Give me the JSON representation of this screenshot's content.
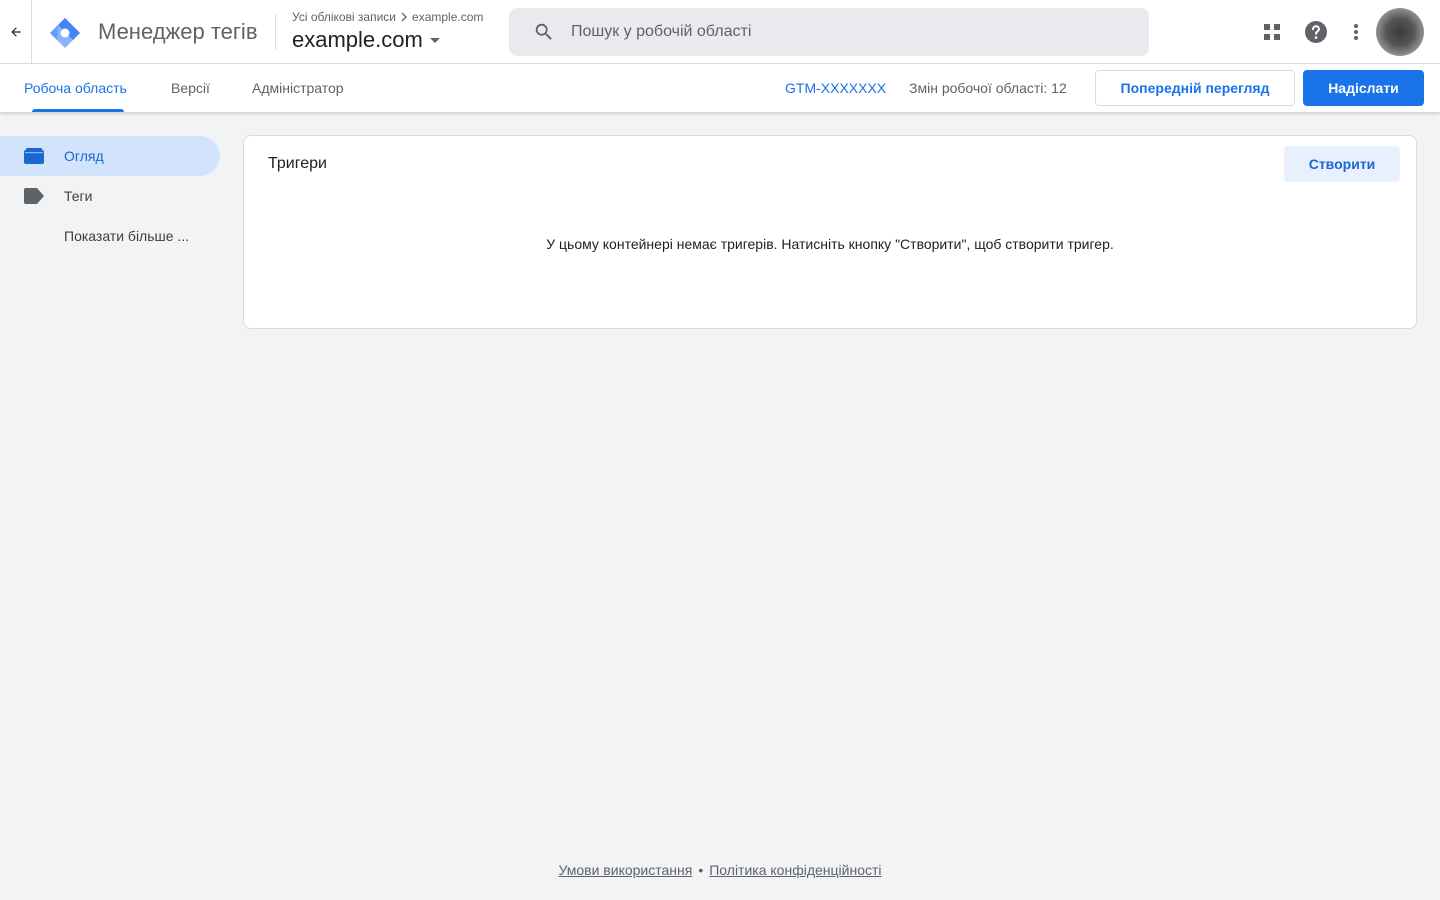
{
  "app": {
    "product_name": "Менеджер тегів",
    "breadcrumb_root": "Усі облікові записи",
    "breadcrumb_account": "example.com",
    "container_name": "example.com"
  },
  "search": {
    "placeholder": "Пошук у робочій області"
  },
  "tabs": [
    {
      "label": "Робоча область",
      "active": true
    },
    {
      "label": "Версії",
      "active": false
    },
    {
      "label": "Адміністратор",
      "active": false
    }
  ],
  "toolbar": {
    "container_id": "GTM-XXXXXXX",
    "changes_label": "Змін робочої області: 12",
    "preview_label": "Попередній перегляд",
    "submit_label": "Надіслати"
  },
  "sidebar": {
    "items": [
      {
        "label": "Огляд",
        "icon": "folder-icon",
        "active": true
      },
      {
        "label": "Теги",
        "icon": "tag-icon",
        "active": false
      },
      {
        "label": "Показати більше ...",
        "icon": "",
        "active": false
      }
    ]
  },
  "main": {
    "card_title": "Тригери",
    "create_label": "Створити",
    "empty_message": "У цьому контейнері немає тригерів. Натисніть кнопку \"Створити\", щоб створити тригер."
  },
  "footer": {
    "terms": "Умови використання",
    "separator": "•",
    "privacy": "Політика конфіденційності"
  },
  "colors": {
    "accent": "#1a73e8",
    "background": "#f1f3f4",
    "active_nav_bg": "#d2e3fc"
  }
}
